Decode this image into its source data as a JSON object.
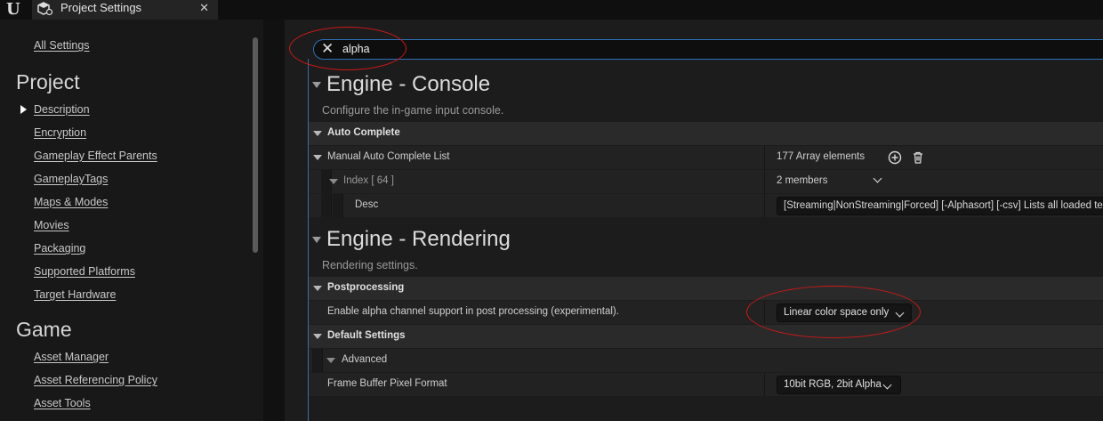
{
  "tab": {
    "title": "Project Settings",
    "close": "✕"
  },
  "sidebar": {
    "all_settings": "All Settings",
    "project_title": "Project",
    "project_items": [
      "Description",
      "Encryption",
      "Gameplay Effect Parents",
      "GameplayTags",
      "Maps & Modes",
      "Movies",
      "Packaging",
      "Supported Platforms",
      "Target Hardware"
    ],
    "game_title": "Game",
    "game_items": [
      "Asset Manager",
      "Asset Referencing Policy",
      "Asset Tools"
    ]
  },
  "search": {
    "value": "alpha",
    "clear": "✕"
  },
  "engine_console": {
    "title": "Engine - Console",
    "description": "Configure the in-game input console.",
    "auto_complete": "Auto Complete",
    "manual_list_label": "Manual Auto Complete List",
    "manual_list_value": "177 Array elements",
    "index_label": "Index [ 64 ]",
    "index_value": "2 members",
    "desc_label": "Desc",
    "desc_value": "[Streaming|NonStreaming|Forced] [-Alphasort] [-csv] Lists all loaded textures and their current memory footprint"
  },
  "engine_rendering": {
    "title": "Engine - Rendering",
    "description": "Rendering settings.",
    "postprocessing": "Postprocessing",
    "alpha_label": "Enable alpha channel support in post processing (experimental).",
    "alpha_value": "Linear color space only",
    "default_settings": "Default Settings",
    "advanced": "Advanced",
    "fb_label": "Frame Buffer Pixel Format",
    "fb_value": "10bit RGB, 2bit Alpha"
  },
  "colors": {
    "highlight_ellipse": "#d01818",
    "search_border": "#2f6fb6"
  }
}
